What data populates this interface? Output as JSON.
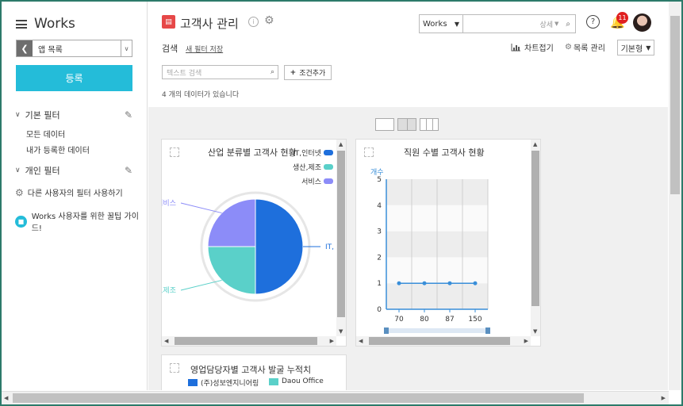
{
  "sidebar": {
    "brand": "Works",
    "app_list_label": "앱 목록",
    "register_label": "등록",
    "basic_filter_label": "기본 필터",
    "basic_filter_items": [
      "모든 데이터",
      "내가 등록한 데이터"
    ],
    "personal_filter_label": "개인 필터",
    "other_user_filter_label": "다른 사용자의 필터 사용하기",
    "guide_label": "Works 사용자를 위한 꿀팁 가이드!"
  },
  "header": {
    "title": "고객사 관리",
    "search_scope": "Works",
    "search_detail": "상세",
    "notification_count": "11"
  },
  "toolbar": {
    "search_label": "검색",
    "save_filter_label": "새 필터 저장",
    "chart_collapse_label": "차트접기",
    "list_manage_label": "목록 관리",
    "view_type": "기본형",
    "text_search_placeholder": "텍스트 검색",
    "add_condition_label": "조건추가",
    "count_text": "4 개의 데이터가 있습니다"
  },
  "chart_data": [
    {
      "type": "pie",
      "title": "산업 분류별 고객사 현황",
      "legend": [
        "IT,인터넷",
        "생산,제조",
        "서비스"
      ],
      "slice_labels": [
        "IT,",
        "생산,제조",
        "서비스"
      ],
      "values": [
        2,
        1,
        1
      ],
      "colors": [
        "#1e6fdc",
        "#5ad0c9",
        "#8c8cf8"
      ]
    },
    {
      "type": "line",
      "title": "직원 수별 고객사 현황",
      "ylabel": "개수",
      "x": [
        "70",
        "80",
        "87",
        "150"
      ],
      "series": [
        {
          "values": [
            1,
            1,
            1,
            1
          ]
        }
      ],
      "ylim": [
        0,
        5
      ],
      "yticks": [
        "5",
        "4",
        "3",
        "2",
        "1",
        "0"
      ],
      "color": "#3a8fd9"
    },
    {
      "type": "line",
      "title": "영업담당자별 고객사 발굴 누적치",
      "legend": [
        "(주)성보엔지니어링",
        "Daou Office"
      ],
      "colors": [
        "#1e6fdc",
        "#5ad0c9"
      ]
    }
  ]
}
